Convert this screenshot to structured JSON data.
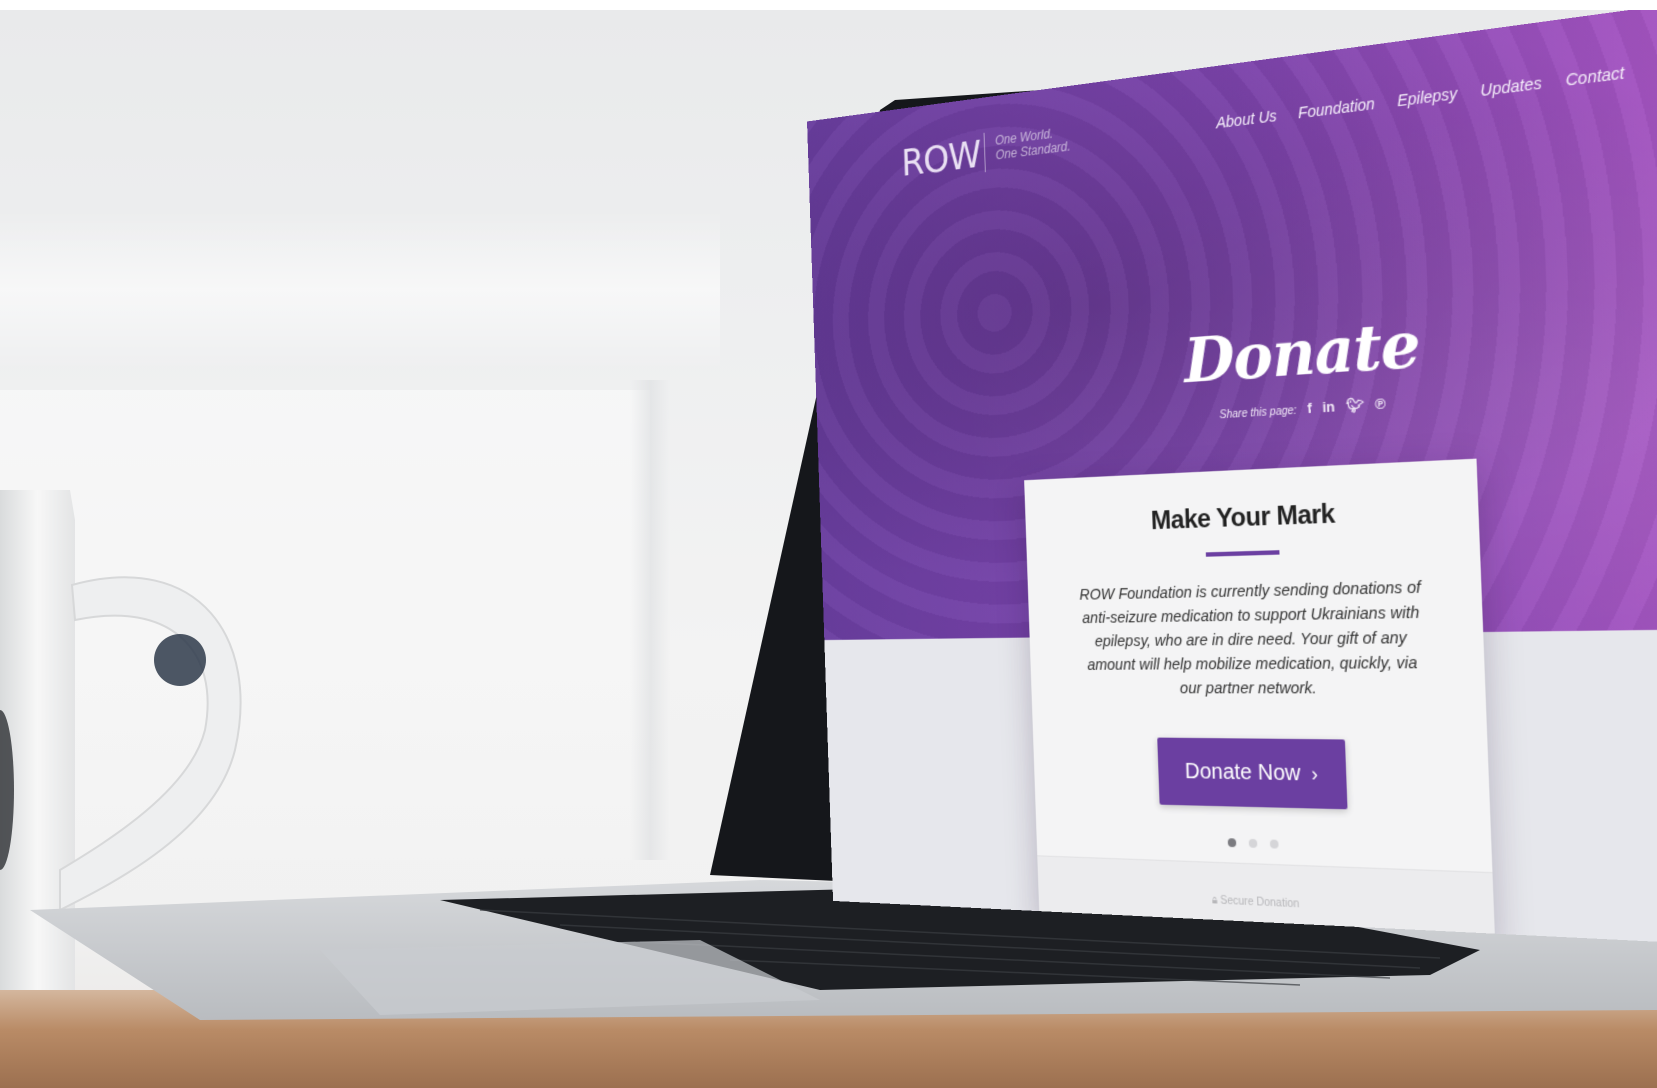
{
  "site": {
    "logo": "ROW",
    "tagline_line1": "One World.",
    "tagline_line2": "One Standard.",
    "nav": [
      "About Us",
      "Foundation",
      "Epilepsy",
      "Updates",
      "Contact"
    ]
  },
  "hero": {
    "title": "Donate",
    "share_label": "Share this page:",
    "social_icons": [
      "facebook-icon",
      "linkedin-icon",
      "twitter-icon",
      "pinterest-icon"
    ]
  },
  "card": {
    "title": "Make Your Mark",
    "body": "ROW Foundation is currently sending donations of anti-seizure medication to support Ukrainians with epilepsy, who are in dire need. Your gift of any amount will help mobilize medication, quickly, via our partner network.",
    "button_label": "Donate Now",
    "button_icon": "chevron-right-icon",
    "dots_count": 3,
    "active_dot": 1,
    "footer": "Secure Donation"
  },
  "colors": {
    "brand_purple": "#6b3fa1",
    "hero_gradient_start": "#6a3ea0",
    "hero_gradient_end": "#b35cc6",
    "card_bg": "#f4f4f5"
  }
}
